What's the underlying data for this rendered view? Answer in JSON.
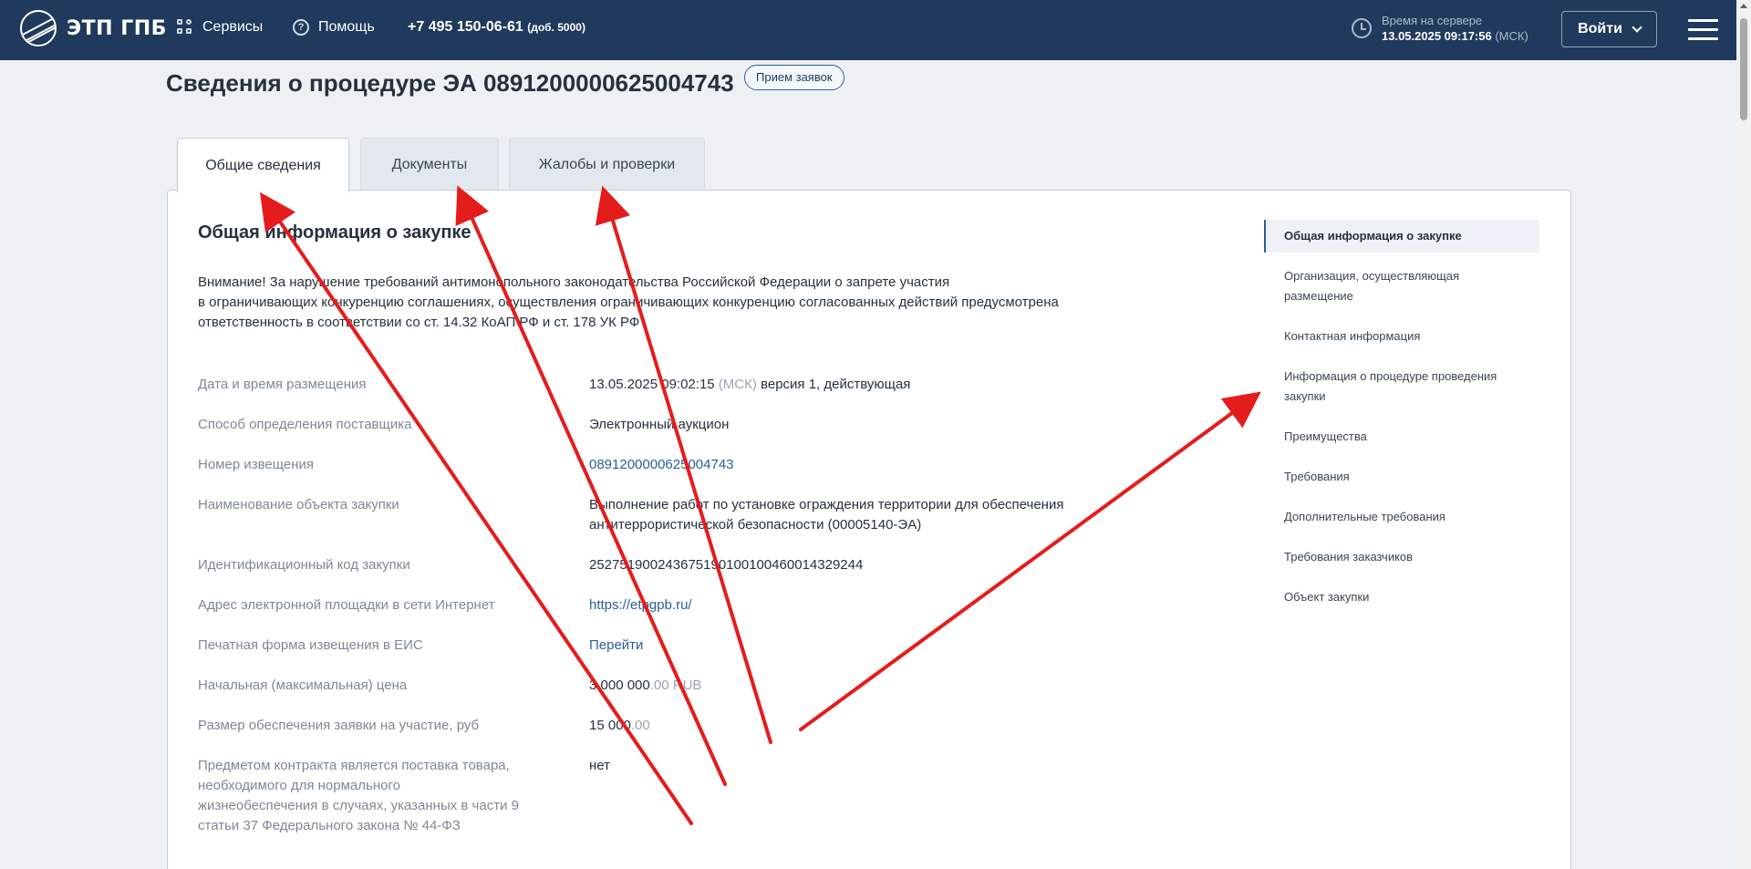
{
  "header": {
    "logo_text": "ЭТП ГПБ",
    "services_label": "Сервисы",
    "help_label": "Помощь",
    "phone": "+7 495 150-06-61",
    "phone_ext": "(доб. 5000)",
    "server_time_label": "Время на сервере",
    "server_time_value": "13.05.2025 09:17:56",
    "server_time_tz": "(МСК)",
    "login_label": "Войти"
  },
  "page": {
    "title": "Сведения о процедуре ЭА 0891200000625004743",
    "status": "Прием заявок"
  },
  "tabs": [
    {
      "label": "Общие сведения"
    },
    {
      "label": "Документы"
    },
    {
      "label": "Жалобы и проверки"
    }
  ],
  "section": {
    "title": "Общая информация о закупке",
    "warning_line1": "Внимание! За нарушение требований антимонопольного законодательства Российской Федерации о запрете участия",
    "warning_line2": "в ограничивающих конкуренцию соглашениях, осуществления ограничивающих конкуренцию согласованных действий предусмотрена",
    "warning_line3": "ответственность в соответствии со ст. 14.32 КоАП РФ и ст. 178 УК РФ"
  },
  "fields": {
    "placement_date_label": "Дата и время размещения",
    "placement_date_value": "13.05.2025 09:02:15",
    "placement_date_tz": "(МСК)",
    "placement_version": "версия 1, действующая",
    "method_label": "Способ определения поставщика",
    "method_value": "Электронный аукцион",
    "notice_label": "Номер извещения",
    "notice_value": "0891200000625004743",
    "object_label": "Наименование объекта закупки",
    "object_value_line1": "Выполнение работ по установке ограждения территории для обеспечения",
    "object_value_line2": "антитеррористической безопасности (00005140-ЭА)",
    "ikz_label": "Идентификационный код закупки",
    "ikz_value": "252751900243675190100100460014329244",
    "site_label": "Адрес электронной площадки в сети Интернет",
    "site_value": "https://etpgpb.ru/",
    "print_label": "Печатная форма извещения в ЕИС",
    "print_value": "Перейти",
    "price_label": "Начальная (максимальная) цена",
    "price_int": "3 000 000",
    "price_dec": ".00 RUB",
    "deposit_label": "Размер обеспечения заявки на участие, руб",
    "deposit_int": "15 000",
    "deposit_dec": ".00",
    "vital_label_line1": "Предметом контракта является поставка товара,",
    "vital_label_line2": "необходимого для нормального",
    "vital_label_line3": "жизнеобеспечения в случаях, указанных в части 9",
    "vital_label_line4": "статьи 37 Федерального закона № 44-ФЗ",
    "vital_value": "нет"
  },
  "right_nav": [
    {
      "label": "Общая информация о закупке"
    },
    {
      "label": "Организация, осуществляющая размещение"
    },
    {
      "label": "Контактная информация"
    },
    {
      "label": "Информация о процедуре проведения закупки"
    },
    {
      "label": "Преимущества"
    },
    {
      "label": "Требования"
    },
    {
      "label": "Дополнительные требования"
    },
    {
      "label": "Требования заказчиков"
    },
    {
      "label": "Объект закупки"
    }
  ],
  "colors": {
    "header_bg": "#1f3a5c",
    "link": "#2a5d99",
    "annotation_arrow": "#e51c1c"
  }
}
